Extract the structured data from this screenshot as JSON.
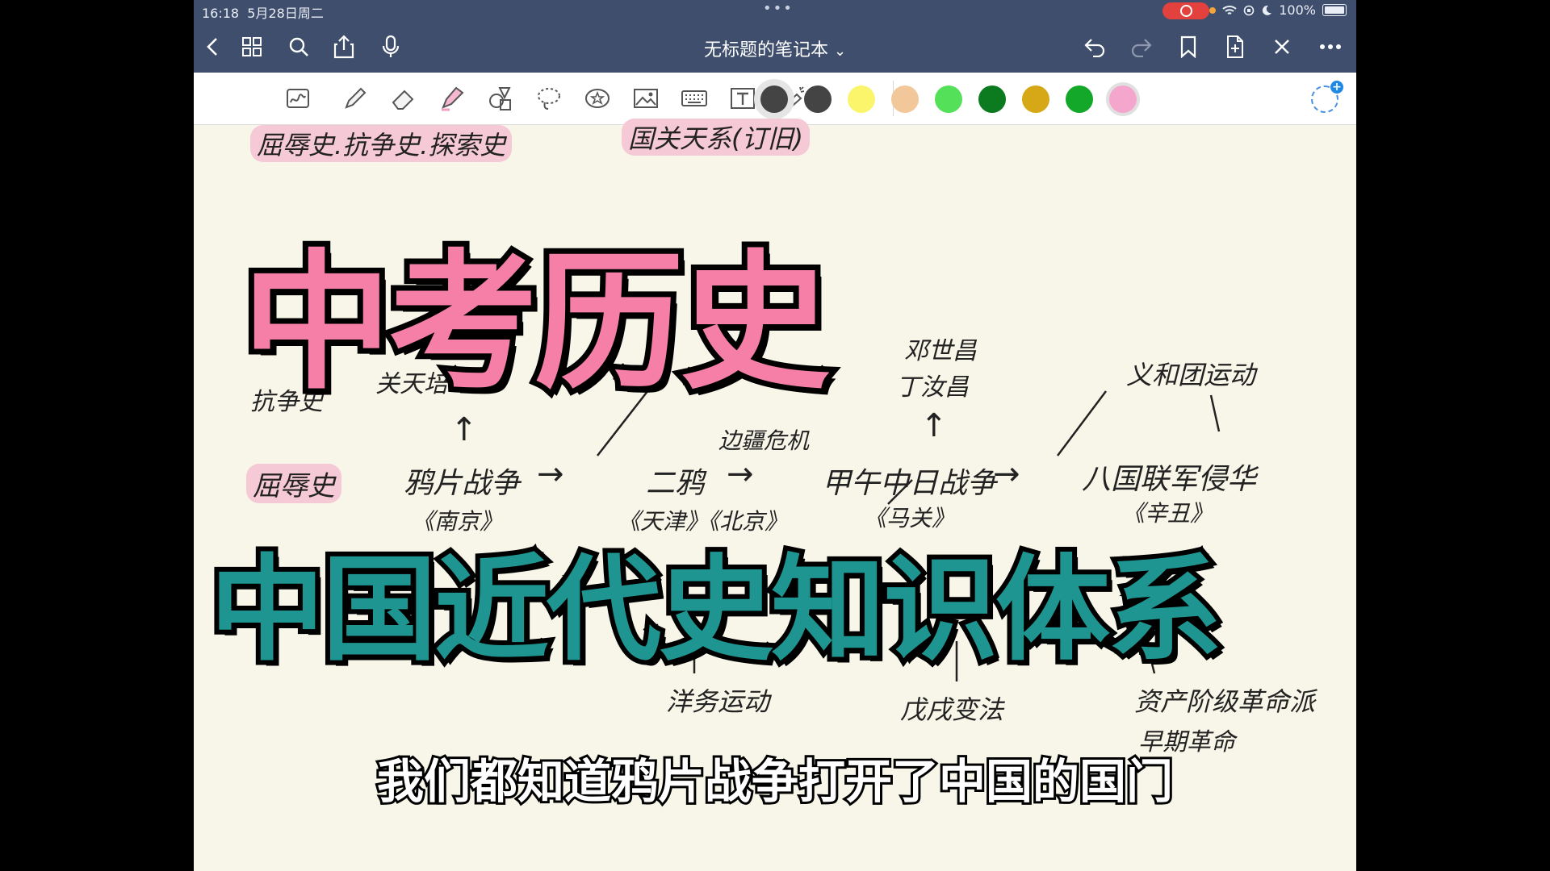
{
  "status": {
    "time": "16:18",
    "date": "5月28日周二",
    "battery": "100%"
  },
  "nav": {
    "title": "无标题的笔记本",
    "title_chevron": "⌄",
    "left_icons": [
      "back-icon",
      "grid-icon",
      "search-icon",
      "share-icon",
      "mic-icon"
    ],
    "right_icons": [
      "undo-icon",
      "redo-icon",
      "bookmark-icon",
      "add-page-icon",
      "close-icon",
      "more-icon"
    ]
  },
  "toolbar": {
    "tools": [
      "shape-handwrite-icon",
      "pen-icon",
      "eraser-icon",
      "highlighter-icon",
      "shapes-icon",
      "lasso-icon",
      "sticker-icon",
      "image-icon",
      "keyboard-icon",
      "text-icon",
      "laser-icon"
    ],
    "colors": [
      "#444444",
      "#444444",
      "#fbf56b",
      "#f2c79a",
      "#55e05a",
      "#0c7a1e",
      "#d6a716",
      "#13a82a",
      "#f4a6cc"
    ],
    "selected_color_index": 0
  },
  "note": {
    "top_left_label": "屈辱史.抗争史.探索史",
    "top_right_label": "国关天系(订旧)",
    "resist": "抗争史",
    "guan": "关天培",
    "humiliation": "屈辱史",
    "opium": "鸦片战争",
    "treaty1": "《南京》",
    "arrow1": "→",
    "second_opium": "二鸦",
    "border_crisis": "边疆危机",
    "arrow2": "→",
    "sino_japan": "甲午中日战争",
    "tianjin_beijing": "《天津》《北京》",
    "maguan": "《马关》",
    "deng": "邓世昌",
    "ding": "丁汝昌",
    "arrow3": "→",
    "boxer": "义和团运动",
    "eight_nation": "八国联军侵华",
    "xinchou": "《辛丑》",
    "self_strength": "洋务运动",
    "reform": "戊戌变法",
    "bourgeois": "资产阶级革命派",
    "revolution": "早期革命",
    "up_arrow": "↑"
  },
  "headline": {
    "line1": "中考历史",
    "line2": "中国近代史知识体系"
  },
  "subtitle": "我们都知道鸦片战争打开了中国的国门"
}
